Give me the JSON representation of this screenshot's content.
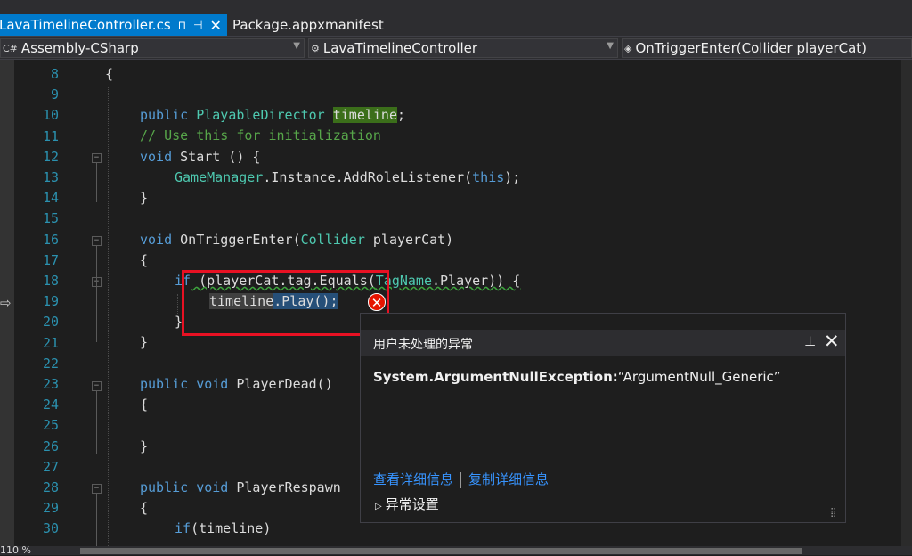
{
  "tabs": [
    {
      "label": "LavaTimelineController.cs",
      "pin": "⊓",
      "pin_icon": "pin-icon",
      "close": "✕"
    },
    {
      "label": "Package.appxmanifest"
    }
  ],
  "navbar": {
    "project": "Assembly-CSharp",
    "project_icon": "C#",
    "class": "LavaTimelineController",
    "member": "OnTriggerEnter(Collider playerCat)"
  },
  "lines": [
    "8",
    "9",
    "10",
    "11",
    "12",
    "13",
    "14",
    "15",
    "16",
    "17",
    "18",
    "19",
    "20",
    "21",
    "22",
    "23",
    "24",
    "25",
    "26",
    "27",
    "28",
    "29",
    "30"
  ],
  "code": {
    "l8": "{",
    "l10_a": "public",
    "l10_b": "PlayableDirector",
    "l10_c": "timeline",
    "l10_d": ";",
    "l11": "// Use this for initialization",
    "l12_a": "void",
    "l12_b": " Start () {",
    "l13_a": "GameManager",
    "l13_b": ".Instance.AddRoleListener(",
    "l13_c": "this",
    "l13_d": ");",
    "l14": "}",
    "l16_a": "void",
    "l16_b": " OnTriggerEnter(",
    "l16_c": "Collider",
    "l16_d": " playerCat)",
    "l17": "{",
    "l18_a": "if",
    "l18_b": " (playerCat.tag.Equals(",
    "l18_c": "TagName",
    "l18_d": ".Player)) {",
    "l19_a": "timeline",
    "l19_b": ".Play();",
    "l20": "}",
    "l21": "}",
    "l23_a": "public",
    "l23_b": "void",
    "l23_c": " PlayerDead()",
    "l24": "{",
    "l26": "}",
    "l28_a": "public",
    "l28_b": "void",
    "l28_c": " PlayerRespawn",
    "l29": "{",
    "l30_a": "if",
    "l30_b": "(timeline)"
  },
  "exception": {
    "title": "用户未处理的异常",
    "type": "System.ArgumentNullException:",
    "message": "“ArgumentNull_Generic”",
    "view_details": "查看详细信息",
    "copy_details": "复制详细信息",
    "settings": "异常设置"
  },
  "status": {
    "zoom": "110 %"
  },
  "colors": {
    "accent": "#007acc",
    "error": "#e51400",
    "link": "#3794ff"
  }
}
